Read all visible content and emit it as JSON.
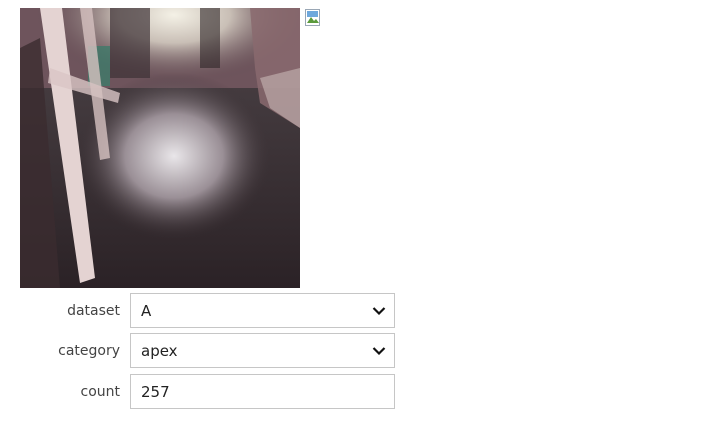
{
  "image": {
    "description_icon": "photo-floor-scene",
    "broken_icon": "broken-image-icon"
  },
  "form": {
    "dataset": {
      "label": "dataset",
      "value": "A"
    },
    "category": {
      "label": "category",
      "value": "apex"
    },
    "count": {
      "label": "count",
      "value": "257"
    }
  }
}
